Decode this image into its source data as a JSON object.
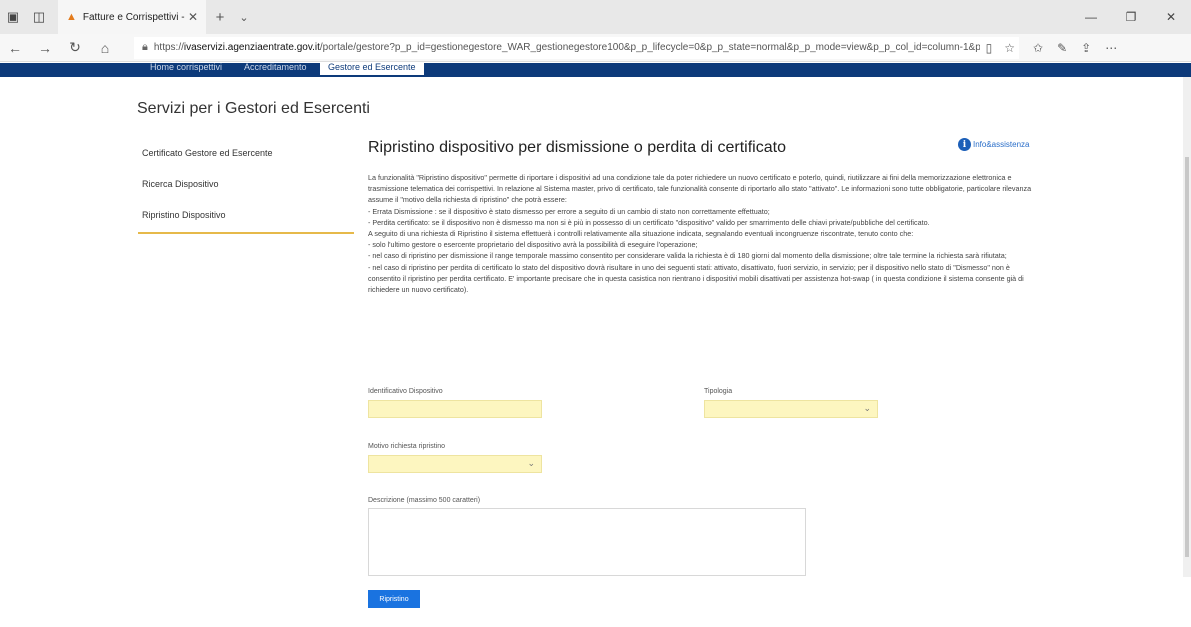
{
  "browser": {
    "tab_title": "Fatture e Corrispettivi -",
    "url_prefix": "https://",
    "url_host": "ivaservizi.agenziaentrate.gov.it",
    "url_path": "/portale/gestore?p_p_id=gestionegestore_WAR_gestionegestore100&p_p_lifecycle=0&p_p_state=normal&p_p_mode=view&p_p_col_id=column-1&p"
  },
  "topnav": {
    "items": [
      "Home corrispettivi",
      "Accreditamento",
      "Gestore ed Esercente"
    ]
  },
  "section_title": "Servizi per i Gestori ed Esercenti",
  "sidebar": {
    "items": [
      {
        "label": "Certificato Gestore ed Esercente"
      },
      {
        "label": "Ricerca Dispositivo"
      },
      {
        "label": "Ripristino Dispositivo"
      }
    ]
  },
  "main": {
    "title": "Ripristino dispositivo per dismissione o perdita di certificato",
    "info_link": "Info&assistenza",
    "paragraphs": [
      "La funzionalità \"Ripristino dispositivo\" permette di riportare i dispositivi ad una condizione tale da poter richiedere un nuovo certificato e poterlo, quindi, riutilizzare ai fini della memorizzazione elettronica e trasmissione telematica dei corrispettivi. In relazione al Sistema master, privo di certificato, tale funzionalità consente di riportarlo allo stato \"attivato\". Le informazioni sono tutte obbligatorie, particolare rilevanza assume il \"motivo della richiesta di ripristino\" che potrà essere:",
      " - Errata Dismissione : se il dispositivo è stato dismesso per errore a seguito di un cambio di stato non correttamente effettuato;",
      " - Perdita certificato: se il dispositivo non è dismesso ma non si è più in possesso di un certificato \"dispositivo\" valido per smarrimento delle chiavi private/pubbliche del certificato.",
      "A seguito di una richiesta di Ripristino il sistema effettuerà i controlli relativamente alla situazione indicata, segnalando eventuali incongruenze riscontrate, tenuto conto che:",
      " - solo l'ultimo gestore o esercente proprietario del dispositivo avrà la possibilità di eseguire l'operazione;",
      " - nel caso di ripristino per dismissione il range temporale massimo consentito per considerare valida la richiesta è di 180 giorni dal momento della dismissione; oltre tale termine la richiesta sarà rifiutata;",
      " - nel caso di ripristino per perdita di certificato lo stato del dispositivo dovrà risultare in uno dei seguenti stati: attivato, disattivato, fuori servizio, in servizio; per il dispositivo nello stato di \"Dismesso\" non è consentito il ripristino per perdita certificato. E' importante precisare che in questa casistica non rientrano i dispositivi mobili disattivati per assistenza hot-swap ( in questa condizione il sistema consente già di richiedere un nuovo certificato)."
    ]
  },
  "form": {
    "id_label": "Identificativo Dispositivo",
    "id_value": "",
    "type_label": "Tipologia",
    "type_value": "",
    "reason_label": "Motivo richiesta ripristino",
    "reason_value": "",
    "desc_label": "Descrizione (massimo 500 caratteri)",
    "desc_value": "",
    "submit_label": "Ripristino"
  },
  "colors": {
    "nav_blue": "#0d3a7a",
    "field_yellow": "#fdf6c0",
    "button_blue": "#1a73e0",
    "sidebar_underline": "#e6b94a"
  }
}
